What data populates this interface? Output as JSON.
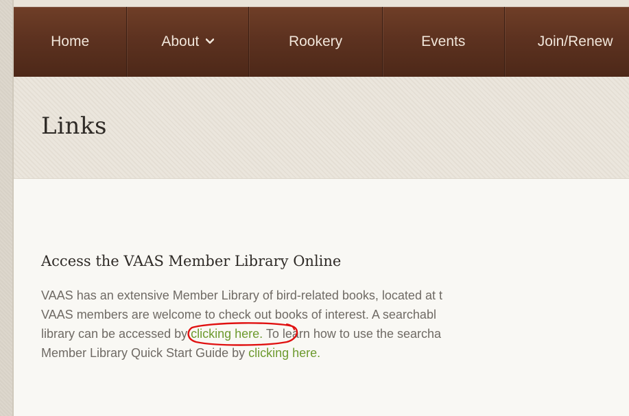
{
  "nav": {
    "items": [
      {
        "label": "Home"
      },
      {
        "label": "About",
        "has_dropdown": true
      },
      {
        "label": "Rookery"
      },
      {
        "label": "Events"
      },
      {
        "label": "Join/Renew"
      }
    ]
  },
  "page": {
    "title": "Links"
  },
  "section": {
    "heading": "Access the VAAS Member Library Online",
    "line1": "VAAS has an extensive Member Library of bird-related books, located at t",
    "line2": "VAAS members are welcome to check out books of interest. A searchabl",
    "line3_prefix": "library can be accessed by ",
    "link1_text": "clicking here.",
    "line3_suffix": " To learn how to use the searcha",
    "line4_prefix": "Member Library Quick Start Guide by ",
    "link2_text": "clicking here."
  },
  "colors": {
    "nav_bg": "#5d3220",
    "link": "#6d9a2e",
    "annotation": "#e01010"
  }
}
